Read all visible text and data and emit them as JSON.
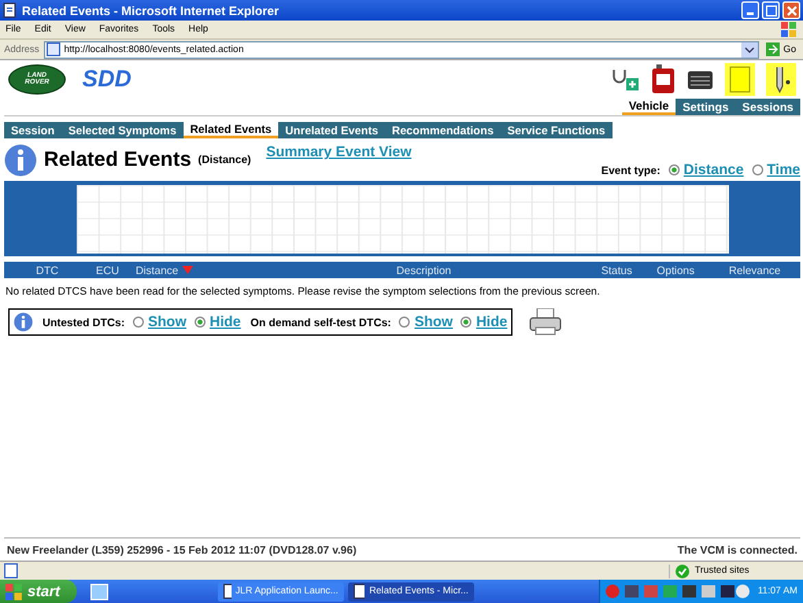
{
  "window": {
    "title": "Related Events - Microsoft Internet Explorer"
  },
  "menu": [
    "File",
    "Edit",
    "View",
    "Favorites",
    "Tools",
    "Help"
  ],
  "address": {
    "label": "Address",
    "value": "http://localhost:8080/events_related.action",
    "go": "Go"
  },
  "header": {
    "logo_text": "LAND ROVER",
    "brand": "SDD"
  },
  "top_tabs": [
    {
      "label": "Vehicle",
      "selected": true
    },
    {
      "label": "Settings",
      "selected": false
    },
    {
      "label": "Sessions",
      "selected": false
    }
  ],
  "nav_tabs": [
    {
      "label": "Session",
      "selected": false
    },
    {
      "label": "Selected Symptoms",
      "selected": false
    },
    {
      "label": "Related Events",
      "selected": true
    },
    {
      "label": "Unrelated Events",
      "selected": false
    },
    {
      "label": "Recommendations",
      "selected": false
    },
    {
      "label": "Service Functions",
      "selected": false
    }
  ],
  "page": {
    "title": "Related Events",
    "subtitle": "(Distance)",
    "summary_link": "Summary Event View"
  },
  "event_type": {
    "label": "Event type:",
    "options": [
      {
        "label": "Distance",
        "selected": true
      },
      {
        "label": "Time",
        "selected": false
      }
    ]
  },
  "columns": [
    {
      "label": "DTC",
      "sorted": false
    },
    {
      "label": "ECU",
      "sorted": false
    },
    {
      "label": "Distance",
      "sorted": true
    },
    {
      "label": "Description",
      "sorted": false
    },
    {
      "label": "Status",
      "sorted": false
    },
    {
      "label": "Options",
      "sorted": false
    },
    {
      "label": "Relevance",
      "sorted": false
    }
  ],
  "message": "No related DTCS have been read for the selected symptoms. Please revise the symptom selections from the previous screen.",
  "filters": [
    {
      "label": "Untested DTCs:",
      "options": [
        {
          "label": "Show",
          "selected": false
        },
        {
          "label": "Hide",
          "selected": true
        }
      ]
    },
    {
      "label": "On demand self-test DTCs:",
      "options": [
        {
          "label": "Show",
          "selected": false
        },
        {
          "label": "Hide",
          "selected": true
        }
      ]
    }
  ],
  "footer": {
    "vehicle": "New Freelander (L359) 252996 - 15 Feb 2012 11:07 (DVD128.07 v.96)",
    "status": "The VCM is connected."
  },
  "ie_status": {
    "zone": "Trusted sites"
  },
  "taskbar": {
    "start": "start",
    "tasks": [
      {
        "label": "JLR Application Launc...",
        "selected": false
      },
      {
        "label": "Related Events - Micr...",
        "selected": true
      }
    ],
    "clock": "11:07 AM"
  }
}
